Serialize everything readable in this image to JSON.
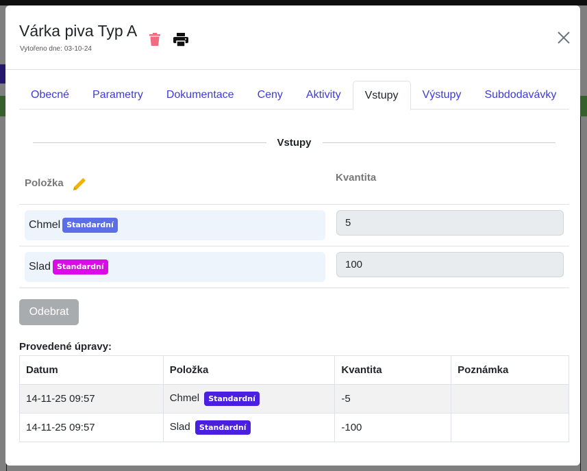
{
  "modal": {
    "title": "Várka piva Typ A",
    "created_label": "Vytořeno dne:",
    "created_date": "03-10-24",
    "icons": {
      "delete": "trash-icon",
      "print": "printer-icon",
      "close": "close-icon"
    }
  },
  "tabs": [
    {
      "label": "Obecné",
      "active": false
    },
    {
      "label": "Parametry",
      "active": false
    },
    {
      "label": "Dokumentace",
      "active": false
    },
    {
      "label": "Ceny",
      "active": false
    },
    {
      "label": "Aktivity",
      "active": false
    },
    {
      "label": "Vstupy",
      "active": true
    },
    {
      "label": "Výstupy",
      "active": false
    },
    {
      "label": "Subdodavávky",
      "active": false
    }
  ],
  "inputs": {
    "section_title": "Vstupy",
    "col_item": "Položka",
    "col_quantity": "Kvantita",
    "rows": [
      {
        "item": "Chmel",
        "badge": "Standardní",
        "badge_color": "#5b6ee8",
        "quantity": "5"
      },
      {
        "item": "Slad",
        "badge": "Standardní",
        "badge_color": "#d90ce5",
        "quantity": "100"
      }
    ],
    "remove_label": "Odebrat"
  },
  "history": {
    "title": "Provedené úpravy:",
    "headers": [
      "Datum",
      "Položka",
      "Kvantita",
      "Poznámka"
    ],
    "badge_color": "#4a1fe0",
    "rows": [
      {
        "date": "14-11-25 09:57",
        "item": "Chmel",
        "badge": "Standardní",
        "quantity": "-5",
        "note": ""
      },
      {
        "date": "14-11-25 09:57",
        "item": "Slad",
        "badge": "Standardní",
        "quantity": "-100",
        "note": ""
      }
    ]
  },
  "colors": {
    "accent": "#3d3bd6",
    "trash": "#f06b80",
    "pencil": "#f0b400"
  }
}
